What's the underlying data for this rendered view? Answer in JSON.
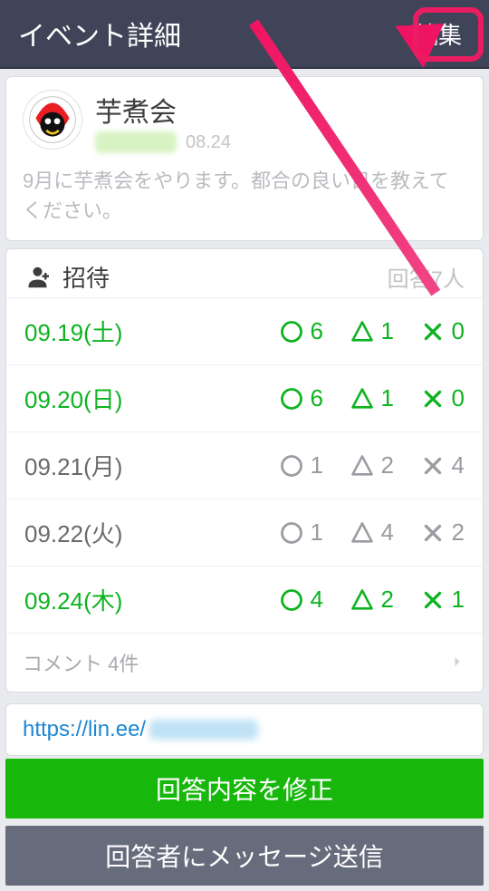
{
  "header": {
    "title": "イベント詳細",
    "edit": "編集"
  },
  "event": {
    "title": "芋煮会",
    "date_small": "08.24",
    "description": "9月に芋煮会をやります。都合の良い日を教えてください。"
  },
  "invite": {
    "label": "招待",
    "answer_label": "回答7人"
  },
  "rows": [
    {
      "date": "09.19(土)",
      "highlight": true,
      "yes": 6,
      "maybe": 1,
      "no": 0
    },
    {
      "date": "09.20(日)",
      "highlight": true,
      "yes": 6,
      "maybe": 1,
      "no": 0
    },
    {
      "date": "09.21(月)",
      "highlight": false,
      "yes": 1,
      "maybe": 2,
      "no": 4
    },
    {
      "date": "09.22(火)",
      "highlight": false,
      "yes": 1,
      "maybe": 4,
      "no": 2
    },
    {
      "date": "09.24(木)",
      "highlight": true,
      "yes": 4,
      "maybe": 2,
      "no": 1
    }
  ],
  "comments": {
    "label": "コメント 4件"
  },
  "share": {
    "url_prefix": "https://lin.ee/"
  },
  "buttons": {
    "edit_answer": "回答内容を修正",
    "send_message": "回答者にメッセージ送信"
  }
}
